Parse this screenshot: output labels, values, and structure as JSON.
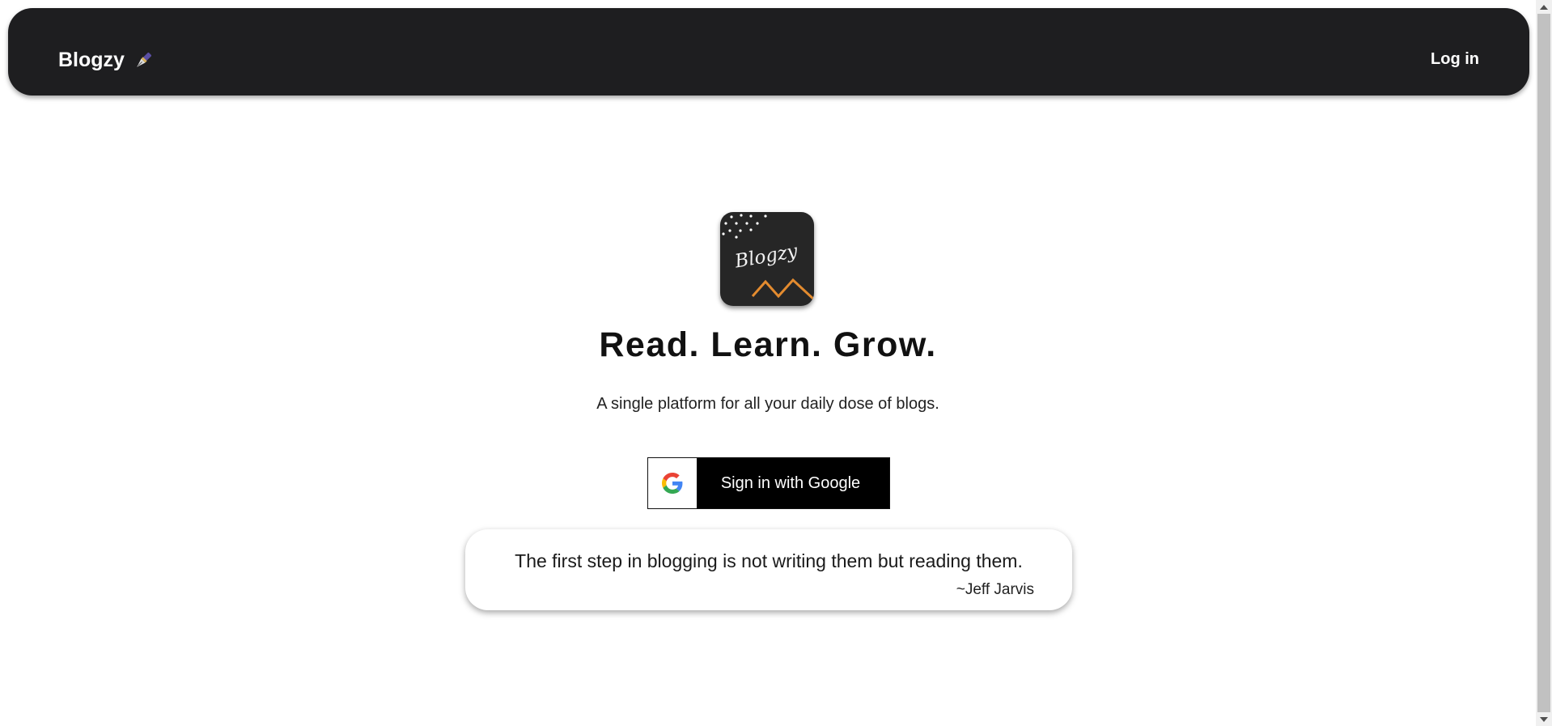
{
  "navbar": {
    "brand": "Blogzy",
    "brand_icon": "fountain-pen-icon",
    "login_label": "Log in"
  },
  "hero": {
    "logo_text": "Blogzy",
    "headline": "Read. Learn. Grow.",
    "subline": "A single platform for all your daily dose of blogs.",
    "google_button": {
      "icon": "google-icon",
      "label": "Sign in with Google"
    }
  },
  "quote": {
    "text": "The first step in blogging is not writing them but reading them.",
    "author": "~Jeff Jarvis"
  },
  "colors": {
    "navbar_bg": "#1e1e20",
    "logo_bg": "#262626",
    "logo_accent": "#e38b2f",
    "button_bg": "#000000"
  }
}
